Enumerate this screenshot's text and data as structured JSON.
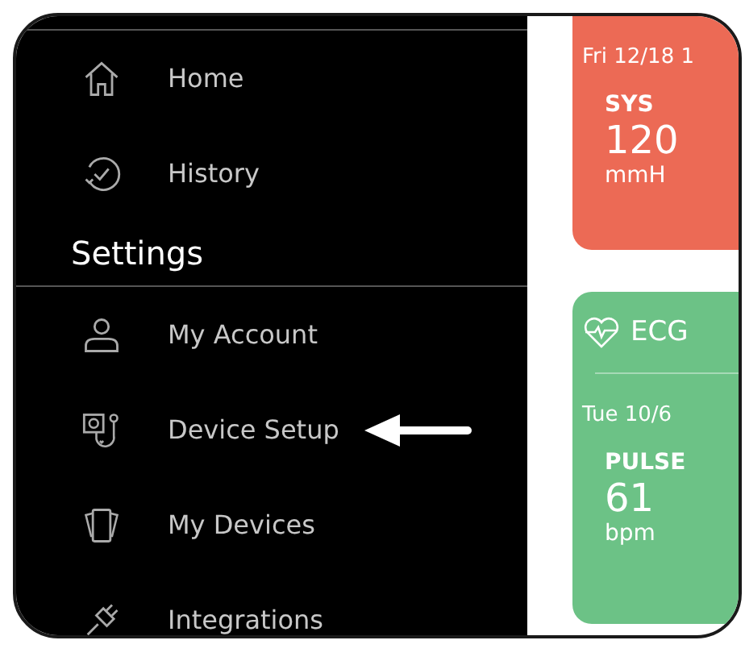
{
  "menu": {
    "items": [
      {
        "label": "Home",
        "kind": "home"
      },
      {
        "label": "History",
        "kind": "history"
      }
    ],
    "section": "Settings",
    "settings_items": [
      {
        "label": "My Account",
        "kind": "account",
        "pointed": false
      },
      {
        "label": "Device Setup",
        "kind": "device",
        "pointed": true
      },
      {
        "label": "My Devices",
        "kind": "devices",
        "pointed": false
      },
      {
        "label": "Integrations",
        "kind": "integrations",
        "pointed": false
      }
    ]
  },
  "cards": [
    {
      "kind": "bp",
      "color": "#ec6a55",
      "date": "Fri 12/18 1",
      "metric": "SYS",
      "value": "120",
      "unit": "mmH"
    },
    {
      "kind": "ecg",
      "color": "#6cc286",
      "title": "ECG",
      "date": "Tue 10/6",
      "metric": "PULSE",
      "value": "61",
      "unit": "bpm"
    }
  ]
}
